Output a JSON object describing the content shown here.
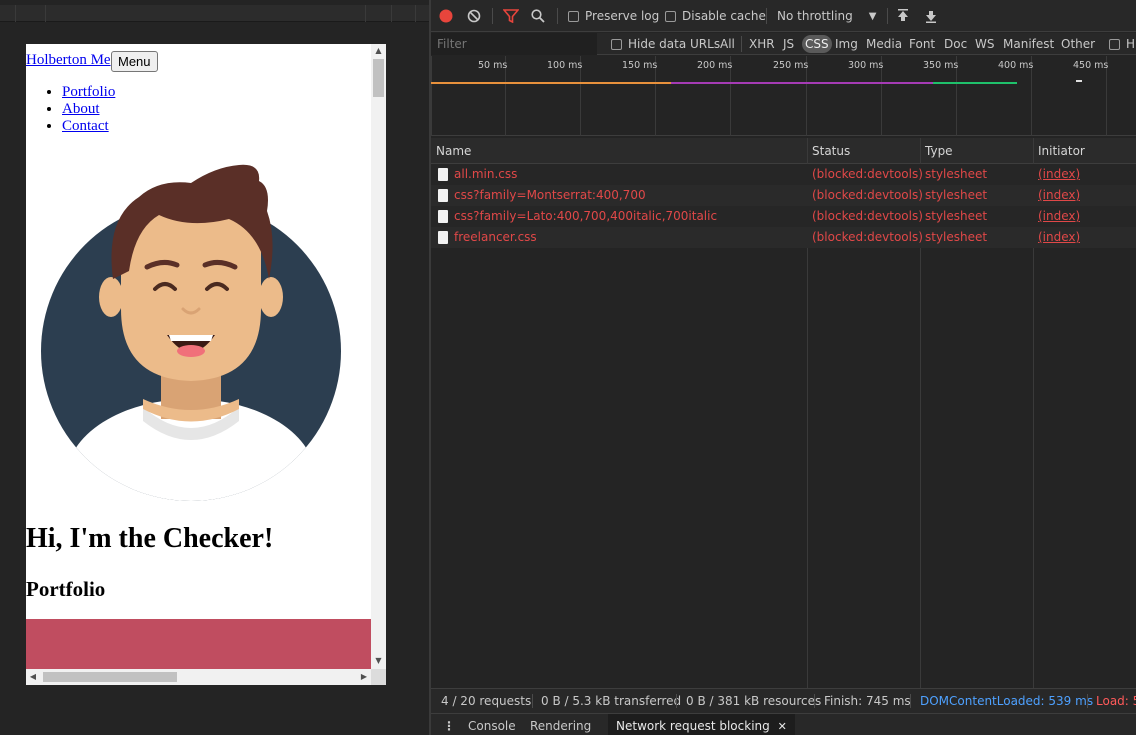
{
  "preview": {
    "brand_link": "Holberton Me",
    "menu_button": "Menu",
    "nav": [
      "Portfolio",
      "About",
      "Contact"
    ],
    "hero_title": "Hi, I'm the Checker!",
    "section_heading": "Portfolio",
    "colors": {
      "avatar_circle": "#2c3e50",
      "portfolio_block": "#c04d60",
      "skin": "#ecbb8a",
      "hair": "#5a2f27"
    }
  },
  "devtools": {
    "toolbar": {
      "record_icon": "record-icon",
      "clear_icon": "clear-icon",
      "filter_icon": "filter-icon",
      "search_icon": "search-icon",
      "preserve_log": "Preserve log",
      "disable_cache": "Disable cache",
      "throttling": "No throttling",
      "import_icon": "upload-icon",
      "export_icon": "download-icon"
    },
    "filter": {
      "placeholder": "Filter",
      "hide_data_urls": "Hide data URLs",
      "types": [
        "All",
        "XHR",
        "JS",
        "CSS",
        "Img",
        "Media",
        "Font",
        "Doc",
        "WS",
        "Manifest",
        "Other"
      ],
      "active_type": "CSS",
      "trailing_checkbox": "H"
    },
    "overview": {
      "ticks": [
        "50 ms",
        "100 ms",
        "150 ms",
        "200 ms",
        "250 ms",
        "300 ms",
        "350 ms",
        "400 ms",
        "450 ms"
      ]
    },
    "table": {
      "headers": {
        "name": "Name",
        "status": "Status",
        "type": "Type",
        "initiator": "Initiator"
      },
      "rows": [
        {
          "name": "all.min.css",
          "status": "(blocked:devtools)",
          "type": "stylesheet",
          "initiator": "(index)"
        },
        {
          "name": "css?family=Montserrat:400,700",
          "status": "(blocked:devtools)",
          "type": "stylesheet",
          "initiator": "(index)"
        },
        {
          "name": "css?family=Lato:400,700,400italic,700italic",
          "status": "(blocked:devtools)",
          "type": "stylesheet",
          "initiator": "(index)"
        },
        {
          "name": "freelancer.css",
          "status": "(blocked:devtools)",
          "type": "stylesheet",
          "initiator": "(index)"
        }
      ]
    },
    "status_bar": {
      "requests": "4 / 20 requests",
      "transferred": "0 B / 5.3 kB transferred",
      "resources": "0 B / 381 kB resources",
      "finish": "Finish: 745 ms",
      "dom_content_loaded": "DOMContentLoaded: 539 ms",
      "load": "Load: 5"
    },
    "drawer": {
      "tabs": [
        "Console",
        "Rendering",
        "Network request blocking"
      ],
      "active_tab": "Network request blocking"
    },
    "colors": {
      "error_red": "#e04848",
      "dcl_blue": "#4ea1ff",
      "load_red": "#ff5a5a"
    }
  }
}
